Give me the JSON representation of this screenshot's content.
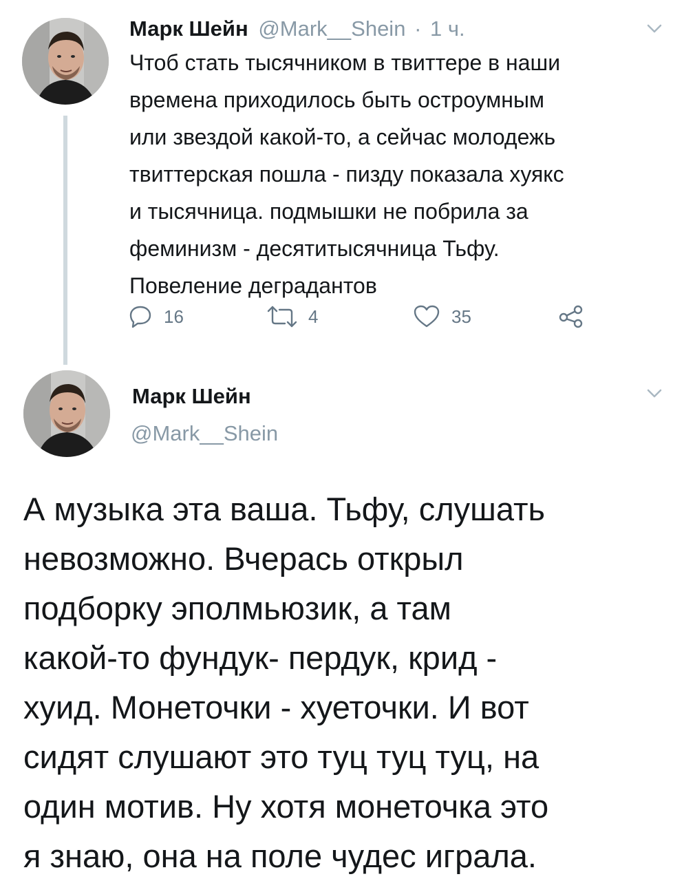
{
  "tweet1": {
    "author_name": "Марк Шейн",
    "author_handle": "@Mark__Shein",
    "separator": "·",
    "time": "1 ч.",
    "text_lines": [
      "Чтоб стать тысячником в твиттере в наши",
      "времена приходилось быть остроумным",
      "или звездой какой-то, а сейчас молодежь",
      "твиттерская пошла - пизду показала хуякс",
      "и тысячница. подмышки не побрила за",
      "феминизм  - десятитысячница Тьфу.",
      "Повеление деградантов"
    ],
    "actions": {
      "reply_count": "16",
      "retweet_count": "4",
      "like_count": "35"
    },
    "icons": {
      "reply": "reply-icon",
      "retweet": "retweet-icon",
      "like": "like-icon",
      "share": "share-icon",
      "menu": "chevron-down-icon"
    }
  },
  "tweet2": {
    "author_name": "Марк Шейн",
    "author_handle": "@Mark__Shein",
    "text_lines": [
      "А музыка эта ваша. Тьфу, слушать",
      "невозможно. Вчерась открыл",
      "подборку эполмьюзик, а там",
      "какой-то фундук-  пердук, крид -",
      "хуид. Монеточки - хуеточки. И вот",
      "сидят слушают это туц туц туц, на",
      "один мотив. Ну хотя монеточка это",
      "я знаю, она на поле чудес играла."
    ],
    "icons": {
      "menu": "chevron-down-icon"
    }
  },
  "colors": {
    "text": "#14171a",
    "muted": "#8899a6",
    "action": "#657786",
    "thread_line": "#cfd9de",
    "background": "#ffffff"
  }
}
